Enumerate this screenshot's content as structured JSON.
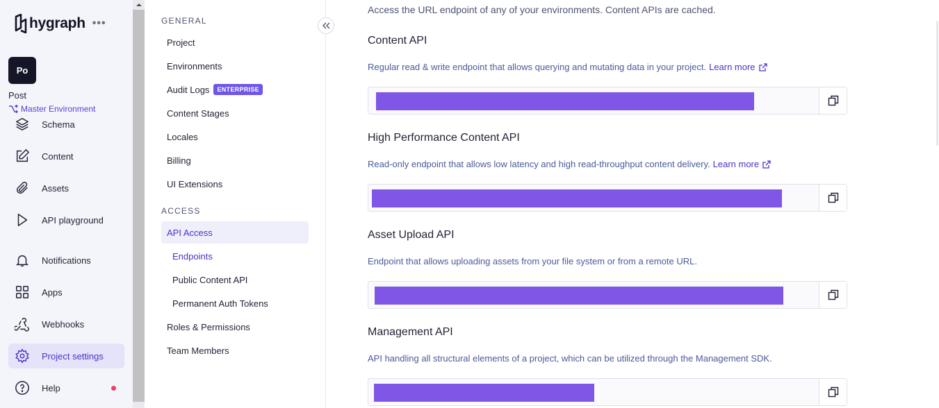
{
  "brand": {
    "name": "hygraph",
    "menu_dots": "•••"
  },
  "project": {
    "avatar": "Po",
    "name": "Post",
    "environment": "Master Environment"
  },
  "app_nav": [
    {
      "key": "schema",
      "label": "Schema",
      "icon": "layers-icon"
    },
    {
      "key": "content",
      "label": "Content",
      "icon": "edit-icon"
    },
    {
      "key": "assets",
      "label": "Assets",
      "icon": "paperclip-icon"
    },
    {
      "key": "api-playground",
      "label": "API playground",
      "icon": "play-icon"
    },
    {
      "key": "notifications",
      "label": "Notifications",
      "icon": "bell-icon"
    },
    {
      "key": "apps",
      "label": "Apps",
      "icon": "grid-icon"
    },
    {
      "key": "webhooks",
      "label": "Webhooks",
      "icon": "webhook-icon"
    },
    {
      "key": "project-settings",
      "label": "Project settings",
      "icon": "gear-icon",
      "active": true
    },
    {
      "key": "help",
      "label": "Help",
      "icon": "help-icon"
    }
  ],
  "settings_menu": {
    "general_title": "GENERAL",
    "general": [
      {
        "label": "Project"
      },
      {
        "label": "Environments"
      },
      {
        "label": "Audit Logs",
        "badge": "ENTERPRISE"
      },
      {
        "label": "Content Stages"
      },
      {
        "label": "Locales"
      },
      {
        "label": "Billing"
      },
      {
        "label": "UI Extensions"
      }
    ],
    "access_title": "ACCESS",
    "access": [
      {
        "label": "API Access"
      },
      {
        "label": "Endpoints"
      },
      {
        "label": "Public Content API"
      },
      {
        "label": "Permanent Auth Tokens"
      },
      {
        "label": "Roles & Permissions"
      },
      {
        "label": "Team Members"
      }
    ]
  },
  "main": {
    "intro": "Access the URL endpoint of any of your environments. Content APIs are cached.",
    "learn_more": "Learn more",
    "apis": [
      {
        "title": "Content API",
        "description": "Regular read & write endpoint that allows querying and mutating data in your project.",
        "has_link": true
      },
      {
        "title": "High Performance Content API",
        "description": "Read-only endpoint that allows low latency and high read-throughput content delivery.",
        "has_link": true
      },
      {
        "title": "Asset Upload API",
        "description": "Endpoint that allows uploading assets from your file system or from a remote URL.",
        "has_link": false
      },
      {
        "title": "Management API",
        "description": "API handling all structural elements of a project, which can be utilized through the Management SDK.",
        "has_link": false
      }
    ]
  },
  "colors": {
    "accent": "#4b31c8",
    "redaction": "#7f56e6",
    "badge": "#6f55e8",
    "notification_dot": "#ea3f6b"
  }
}
